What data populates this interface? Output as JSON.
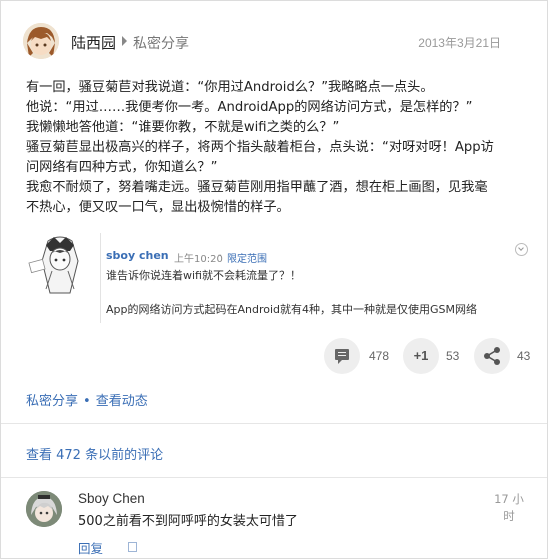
{
  "post": {
    "author": "陆西园",
    "scope": "私密分享",
    "date": "2013年3月21日",
    "lines": [
      "有一回，骚豆菊苣对我说道：“你用过Android么？”我略略点一点头。",
      "他说：“用过……我便考你一考。AndroidApp的网络访问方式，是怎样的？”",
      "我懒懒地答他道：“谁要你教，不就是wifi之类的么？”",
      "骚豆菊苣显出极高兴的样子，将两个指头敲着柜台，点头说：“对呀对呀！App访",
      "问网络有四种方式，你知道么？”",
      "我愈不耐烦了，努着嘴走远。骚豆菊苣刚用指甲蘸了酒，想在柜上画图，见我毫",
      "不热心，便又叹一口气，显出极惋惜的样子。"
    ]
  },
  "reshare": {
    "author": "sboy chen",
    "time": "上午10:20",
    "dot": "-",
    "scope": "限定范围",
    "line1": "谁告诉你说连着wifi就不会耗流量了？！",
    "line2": "App的网络访问方式起码在Android就有4种，其中一种就是仅使用GSM网络"
  },
  "actions": {
    "comment_count": "478",
    "plus_label": "+1",
    "plus_count": "53",
    "share_count": "43"
  },
  "footer": {
    "scope_link": "私密分享",
    "sep": "•",
    "activity_link": "查看动态"
  },
  "older_comments": "查看 472 条以前的评论",
  "comment": {
    "author": "Sboy Chen",
    "text": "500之前看不到阿呼呼的女装太可惜了",
    "time_line1": "17 小",
    "time_line2": "时",
    "reply": "回复"
  },
  "icons": {
    "comment": "comment-bubble-icon",
    "plus": "plus-one-icon",
    "share": "share-icon",
    "menu": "chevron-down-icon"
  }
}
